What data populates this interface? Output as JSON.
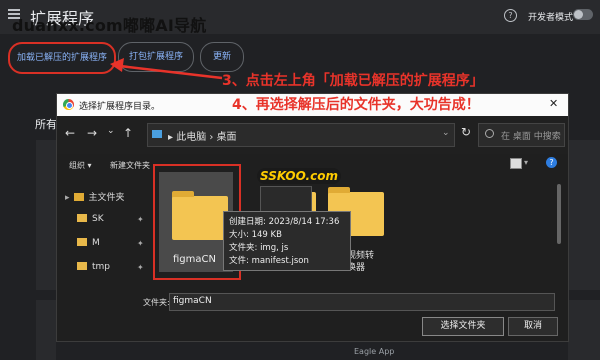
{
  "page": {
    "watermark": "duanxx.com嘟嘟AI导航",
    "title": "扩展程序",
    "dev_mode_label": "开发者模式",
    "buttons": {
      "load": "加载已解压的扩展程序",
      "pack": "打包扩展程序",
      "update": "更新"
    },
    "all_label": "所有",
    "bottom_text": "Eagle App"
  },
  "annotations": {
    "step3": "3、点击左上角「加载已解压的扩展程序」",
    "step4": "4、再选择解压后的文件夹，大功告成！"
  },
  "dialog": {
    "title": "选择扩展程序目录。",
    "close": "✕",
    "address": "▸  此电脑  ›  桌面",
    "search_placeholder": "在 桌面 中搜索",
    "organize": "组织 ▾",
    "new_folder": "新建文件夹",
    "sidebar": [
      {
        "label": "主文件夹",
        "pinned": false
      },
      {
        "label": "SK",
        "pinned": true
      },
      {
        "label": "M",
        "pinned": true
      },
      {
        "label": "tmp",
        "pinned": true
      }
    ],
    "files": {
      "selected": "figmaCN",
      "logo_text": "SSKOO.com",
      "partial_label": "视频转\n换器"
    },
    "tooltip": [
      "创建日期: 2023/8/14 17:36",
      "大小: 149 KB",
      "文件夹: img, js",
      "文件: manifest.json"
    ],
    "filename_label": "文件夹:",
    "filename_value": "figmaCN",
    "select_button": "选择文件夹",
    "cancel_button": "取消"
  },
  "colors": {
    "accent_red": "#d93025",
    "annotation_red": "#e8332a",
    "link_blue": "#8ab4f8",
    "folder_yellow": "#f3c552"
  }
}
